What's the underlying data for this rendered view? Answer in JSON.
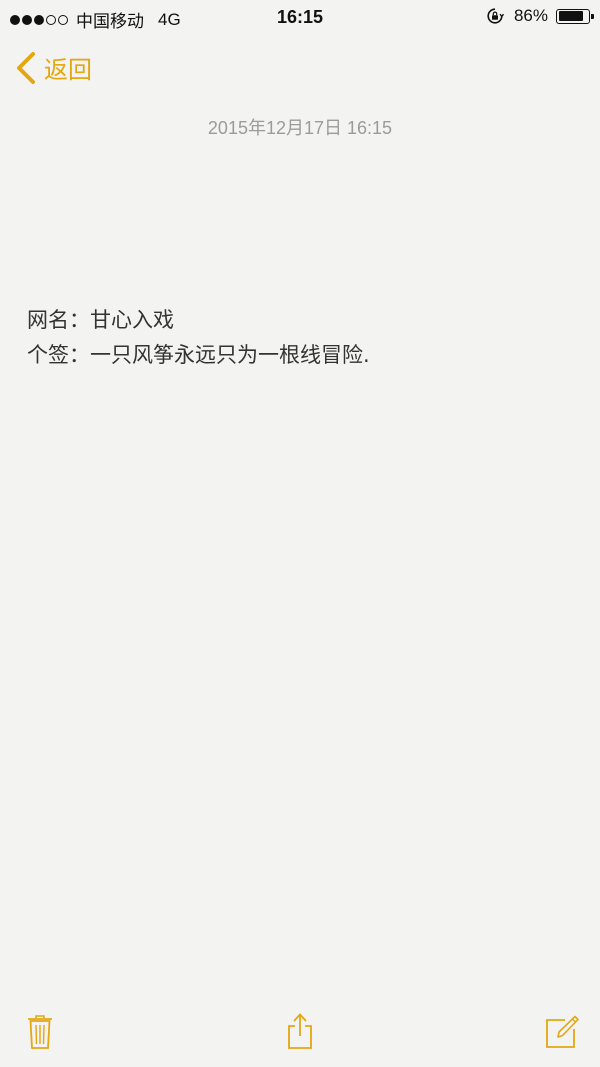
{
  "status_bar": {
    "signal_filled": 3,
    "signal_total": 5,
    "carrier": "中国移动",
    "network": "4G",
    "time": "16:15",
    "battery_percent": "86%",
    "battery_level": 0.86
  },
  "nav": {
    "back_label": "返回",
    "accent_color": "#e3a712"
  },
  "note": {
    "date": "2015年12月17日 16:15",
    "lines": [
      "网名：甘心入戏",
      "个签：一只风筝永远只为一根线冒险."
    ]
  },
  "toolbar": {
    "icons": [
      "trash-icon",
      "share-icon",
      "compose-icon"
    ]
  }
}
